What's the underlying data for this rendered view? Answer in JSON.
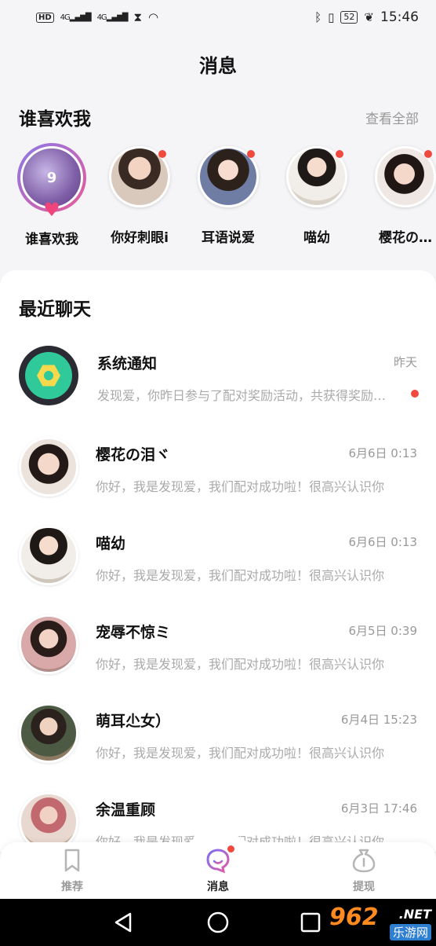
{
  "status_bar": {
    "hd": "HD",
    "signal1": "4G",
    "signal2": "4G",
    "battery": "52",
    "time": "15:46"
  },
  "header": {
    "title": "消息"
  },
  "likes": {
    "title": "谁喜欢我",
    "view_all": "查看全部",
    "first": {
      "count": "9",
      "label": "谁喜欢我"
    },
    "users": [
      {
        "name": "你好刺眼i",
        "unread": true
      },
      {
        "name": "耳语说爱",
        "unread": true
      },
      {
        "name": "喵幼",
        "unread": true
      },
      {
        "name": "樱花の…",
        "unread": true
      }
    ]
  },
  "recent": {
    "title": "最近聊天",
    "chats": [
      {
        "name": "系统通知",
        "time": "昨天",
        "message": "发现爱，你昨日参与了配对奖励活动，共获得奖励…",
        "unread": true,
        "system": true
      },
      {
        "name": "樱花の泪ヾ",
        "time": "6月6日 0:13",
        "message": "你好，我是发现爱，我们配对成功啦！很高兴认识你",
        "unread": false
      },
      {
        "name": "喵幼",
        "time": "6月6日 0:13",
        "message": "你好，我是发现爱，我们配对成功啦！很高兴认识你",
        "unread": false
      },
      {
        "name": "宠辱不惊ミ",
        "time": "6月5日 0:39",
        "message": "你好，我是发现爱，我们配对成功啦！很高兴认识你",
        "unread": false
      },
      {
        "name": "萌耳尐女）",
        "time": "6月4日 15:23",
        "message": "你好，我是发现爱，我们配对成功啦！很高兴认识你",
        "unread": false
      },
      {
        "name": "余温重顾",
        "time": "6月3日 17:46",
        "message": "你好，我是发现爱，我们配对成功啦！很高兴认识你",
        "unread": false
      }
    ]
  },
  "tabs": [
    {
      "label": "推荐",
      "icon": "bookmark-icon",
      "active": false
    },
    {
      "label": "消息",
      "icon": "chat-bubble-icon",
      "active": true
    },
    {
      "label": "提现",
      "icon": "money-bag-icon",
      "active": false
    }
  ],
  "watermark": {
    "number": "962",
    "net": ".NET",
    "sub": "乐游网"
  },
  "colors": {
    "accent": "#8b79ea",
    "heart": "#f0457a",
    "unread": "#f0493e",
    "system_green": "#2fc99a"
  }
}
